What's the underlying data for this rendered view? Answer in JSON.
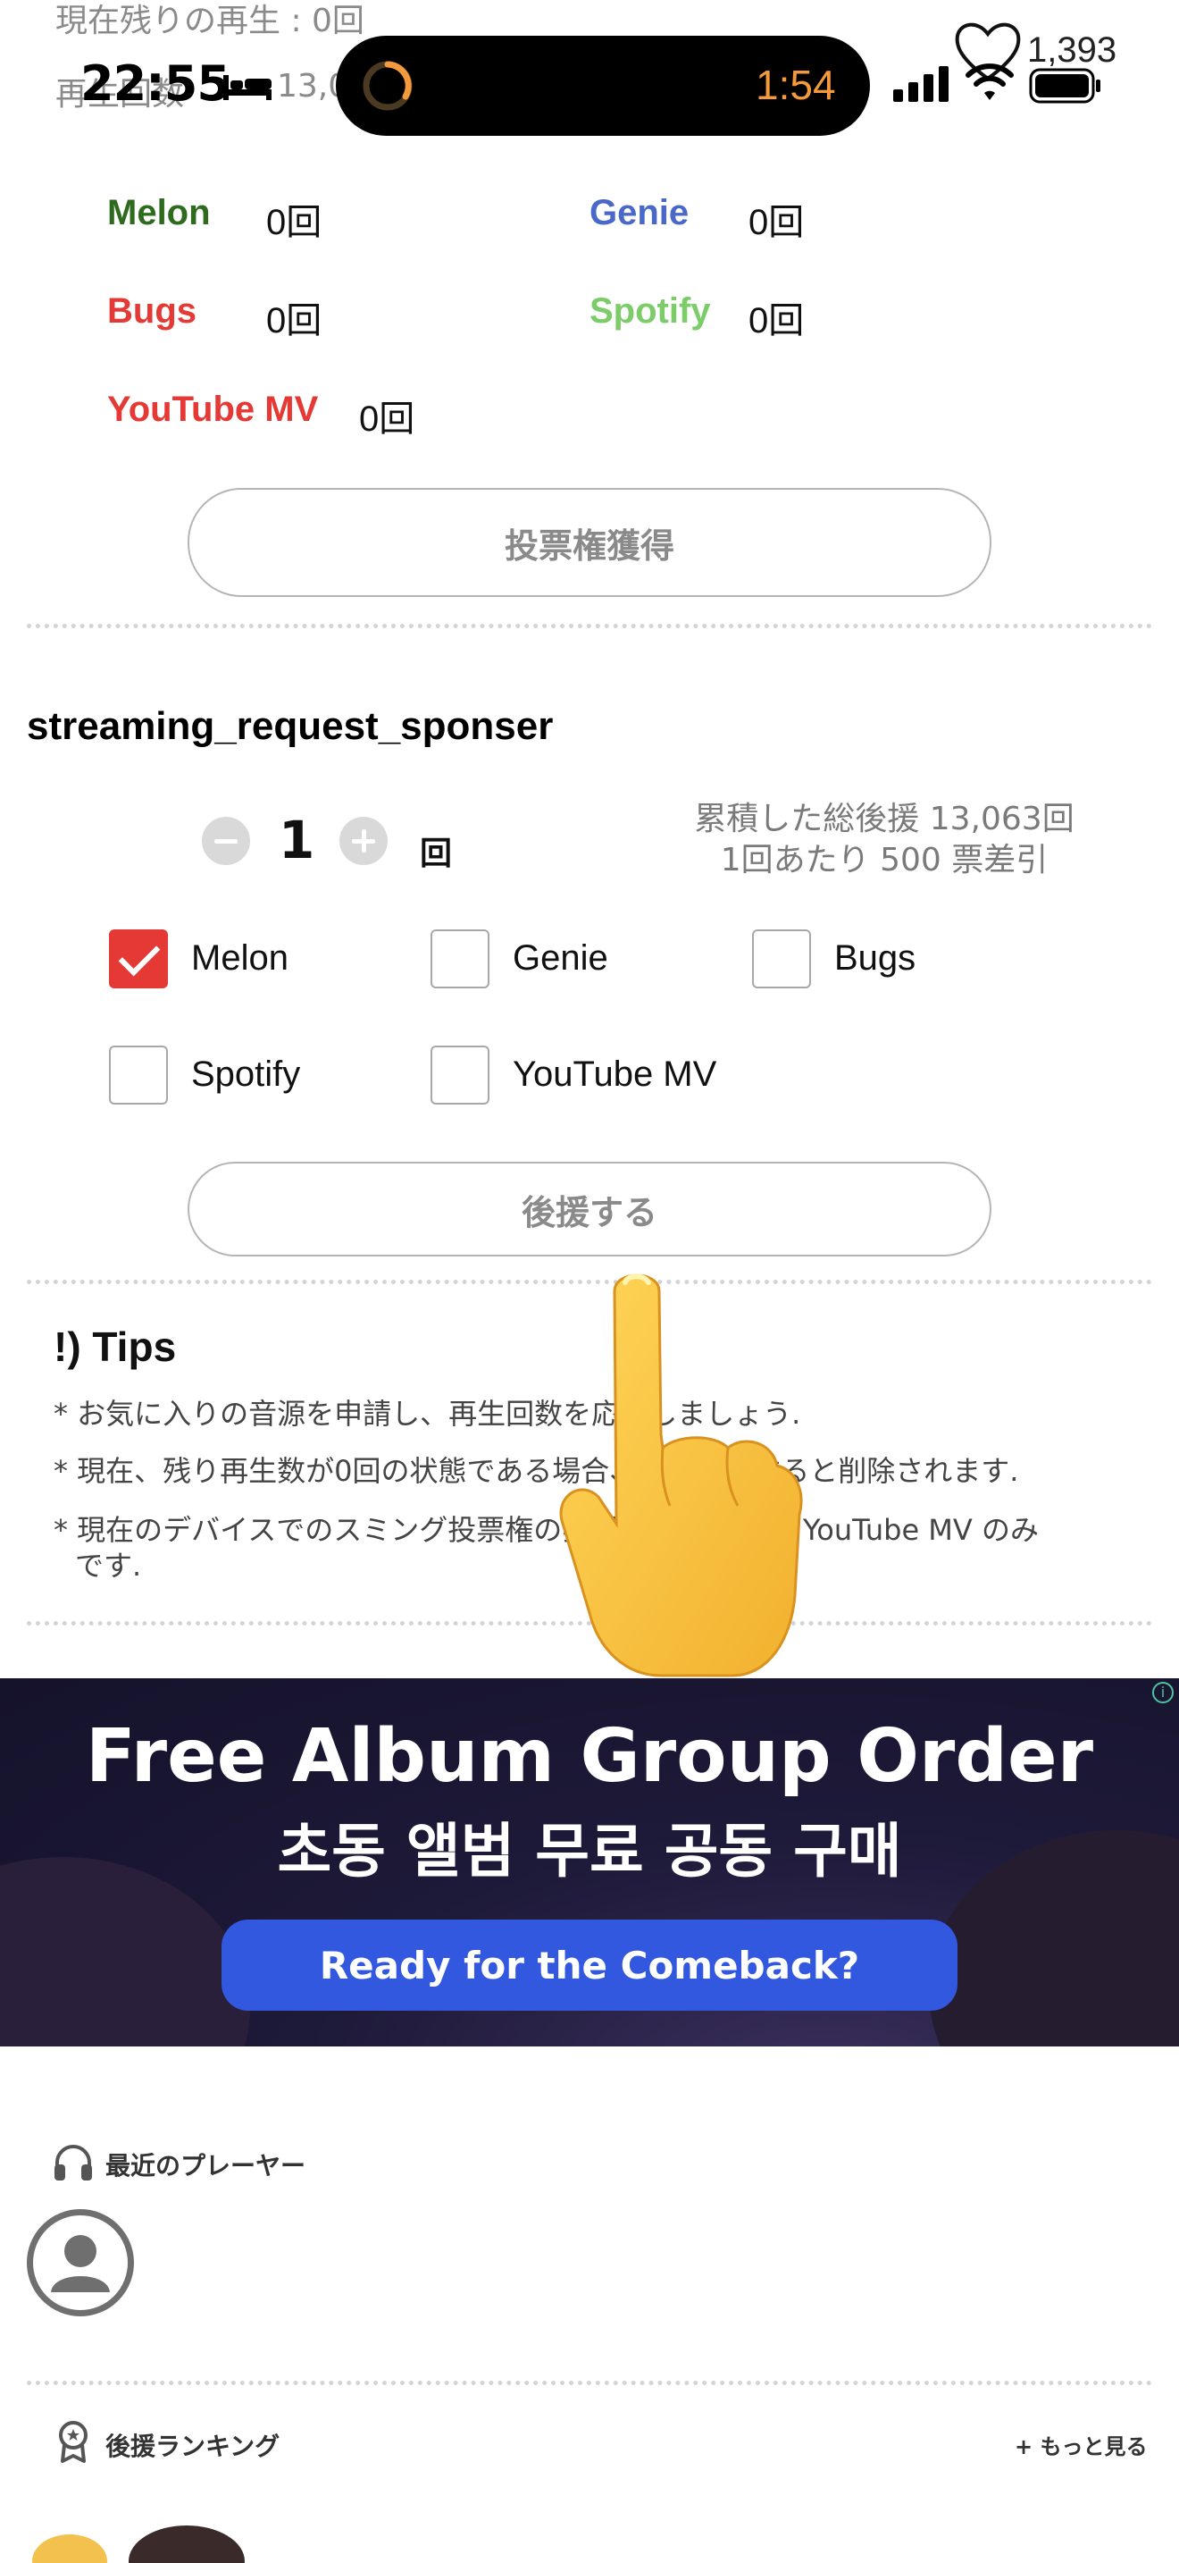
{
  "status_bar": {
    "time": "22:55",
    "timer": "1:54",
    "like_count": "1,393"
  },
  "peek": {
    "remaining_plays": "現在残りの再生 : 0回",
    "count_label": "再生回数",
    "count_value": "13,0"
  },
  "platforms": {
    "items": [
      {
        "name": "Melon",
        "count": "0回",
        "color": "#2e6b1f"
      },
      {
        "name": "Genie",
        "count": "0回",
        "color": "#4a68c8"
      },
      {
        "name": "Bugs",
        "count": "0回",
        "color": "#e53935"
      },
      {
        "name": "Spotify",
        "count": "0回",
        "color": "#7ccc6a"
      },
      {
        "name": "YouTube MV",
        "count": "0回",
        "color": "#e53935"
      }
    ],
    "get_vote_button": "投票権獲得"
  },
  "sponsor": {
    "title": "streaming_request_sponser",
    "quantity": "1",
    "quantity_unit": "回",
    "total_support": "累積した総後援 13,063回",
    "discount": "1回あたり 500 票差引",
    "options": [
      {
        "label": "Melon",
        "checked": true
      },
      {
        "label": "Genie",
        "checked": false
      },
      {
        "label": "Bugs",
        "checked": false
      },
      {
        "label": "Spotify",
        "checked": false
      },
      {
        "label": "YouTube MV",
        "checked": false
      }
    ],
    "support_button": "後援する"
  },
  "tips": {
    "title": "!) Tips",
    "items": [
      "* お気に入りの音源を申請し、再生回数を応援しましょう.",
      "* 現在、残り再生数が0回の状態である場合、しばらくすると削除されます.",
      "* 現在のデバイスでのスミング投票権の獲得は Spotify と YouTube MV のみです."
    ]
  },
  "ad": {
    "title": "Free Album Group Order",
    "subtitle": "초동 앨범 무료 공동 구매",
    "button": "Ready for the Comeback?",
    "info_glyph": "i"
  },
  "recent_players": {
    "title": "最近のプレーヤー"
  },
  "ranking": {
    "title": "後援ランキング",
    "more": "+ もっと見る"
  },
  "icons": {
    "status": [
      "bed-icon",
      "timer-ring-icon",
      "signal-icon",
      "wifi-icon",
      "battery-icon",
      "heart-icon"
    ],
    "sections": [
      "headphones-icon",
      "ribbon-award-icon",
      "user-avatar-icon",
      "pointing-hand-icon"
    ]
  }
}
